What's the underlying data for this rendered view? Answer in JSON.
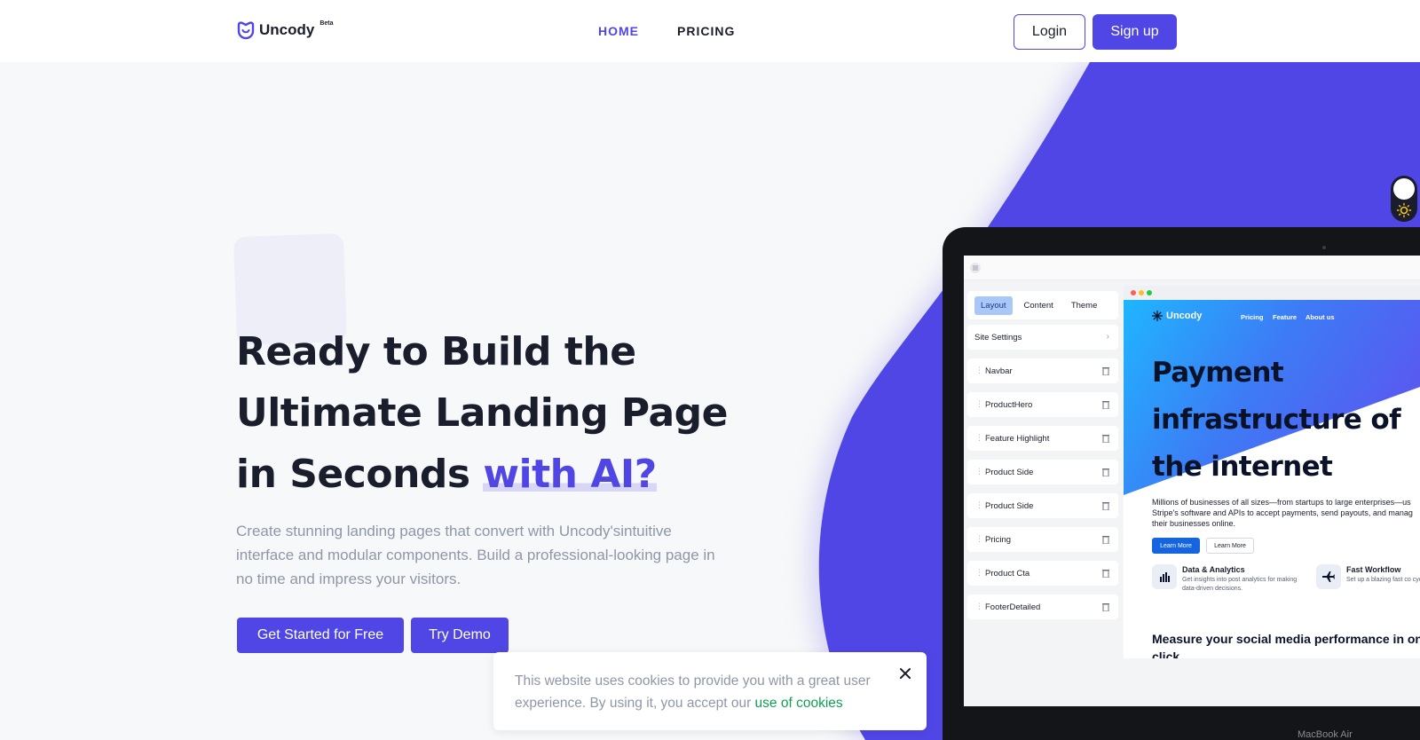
{
  "nav": {
    "logo_text": "Uncody",
    "logo_badge": "Beta",
    "home": "HOME",
    "pricing": "PRICING",
    "login": "Login",
    "signup": "Sign up"
  },
  "hero": {
    "title_part1": "Ready to Build the Ultimate Landing Page in Seconds ",
    "title_accent": "with AI?",
    "subtitle": "Create stunning landing pages that convert with Uncody'sintuitive interface and modular components. Build a professional-looking page in no time and impress your visitors.",
    "cta_primary": "Get Started for Free",
    "cta_secondary": "Try Demo"
  },
  "editor": {
    "tabs": [
      "Layout",
      "Content",
      "Theme"
    ],
    "active_tab": "Layout",
    "site_settings": "Site Settings",
    "layers": [
      "Navbar",
      "ProductHero",
      "Feature Highlight",
      "Product Side",
      "Product Side",
      "Pricing",
      "Product Cta",
      "FooterDetailed"
    ]
  },
  "preview": {
    "logo": "Uncody",
    "nav": [
      "Pricing",
      "Feature",
      "About us"
    ],
    "title": "Payment infrastructure of the internet",
    "body_lines": [
      "Millions of businesses of all sizes—from startups to large enterprises—us",
      "Stripe's software and APIs to accept payments, send payouts, and manag",
      "their businesses online."
    ],
    "btn_primary": "Learn More",
    "btn_secondary": "Learn More",
    "features": [
      {
        "title": "Data & Analytics",
        "desc": "Get insights into post analytics for making data-driven decisions."
      },
      {
        "title": "Fast Workflow",
        "desc": "Set up a blazing fast co cycle."
      }
    ],
    "measure": "Measure your social media performance in one click"
  },
  "laptop_label": "MacBook Air",
  "cookie": {
    "text": "This website uses cookies to provide you with a great user experience. By using it, you accept our ",
    "link": "use of cookies"
  },
  "colors": {
    "brand": "#4f46e5",
    "cookie_link": "#0e9f54",
    "hero_text": "#1a1e2c"
  }
}
